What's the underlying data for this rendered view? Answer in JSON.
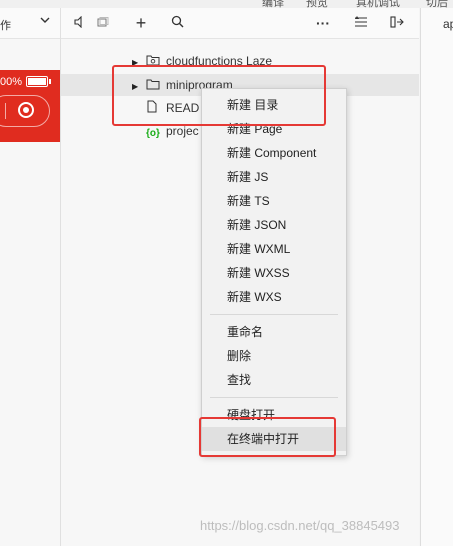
{
  "top_menu": [
    "编译",
    "预览",
    "真机调试",
    "切后台"
  ],
  "simulator": {
    "toolbar_label": "作",
    "battery_text": "00%"
  },
  "explorer": {
    "toolbar": [
      "+",
      "🔍",
      "···",
      "≛",
      "⇤"
    ],
    "tree": [
      {
        "label": "cloudfunctions  Laze",
        "type": "cloud-folder",
        "expandable": true
      },
      {
        "label": "miniprogram",
        "type": "folder",
        "expandable": true,
        "selected": true
      },
      {
        "label": "READ",
        "type": "file",
        "expandable": false
      },
      {
        "label": "projec",
        "type": "config",
        "expandable": false
      }
    ]
  },
  "right_pane": {
    "tab": "ap"
  },
  "context_menu": {
    "groups": [
      [
        "新建 目录",
        "新建 Page",
        "新建 Component",
        "新建 JS",
        "新建 TS",
        "新建 JSON",
        "新建 WXML",
        "新建 WXSS",
        "新建 WXS"
      ],
      [
        "重命名",
        "删除",
        "查找"
      ],
      [
        "硬盘打开",
        "在终端中打开"
      ]
    ]
  },
  "watermark": "https://blog.csdn.net/qq_38845493",
  "colors": {
    "accent_red": "#e02c1f",
    "annotation": "#e53935"
  }
}
